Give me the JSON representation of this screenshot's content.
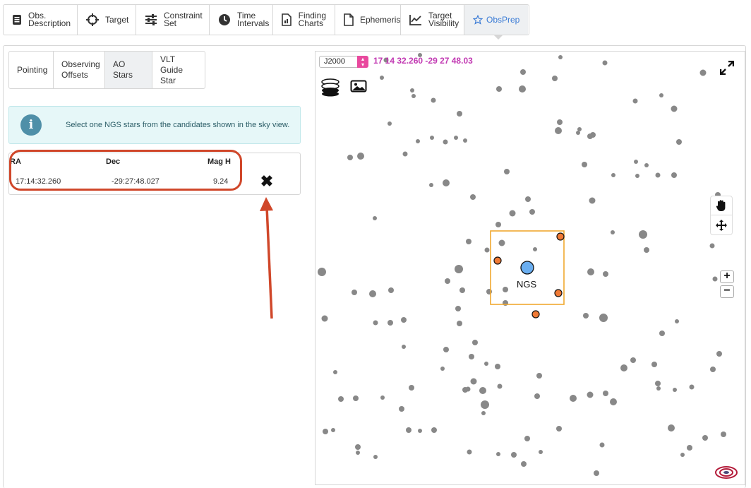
{
  "top_tabs": [
    {
      "label": "Obs.\nDescription",
      "icon": "document-icon",
      "active": false
    },
    {
      "label": "Target",
      "icon": "crosshair-icon",
      "active": false
    },
    {
      "label": "Constraint\nSet",
      "icon": "sliders-icon",
      "active": false
    },
    {
      "label": "Time\nIntervals",
      "icon": "clock-icon",
      "active": false
    },
    {
      "label": "Finding\nCharts",
      "icon": "chart-file-icon",
      "active": false
    },
    {
      "label": "Ephemeris",
      "icon": "file-icon",
      "active": false
    },
    {
      "label": "Target\nVisibility",
      "icon": "line-chart-icon",
      "active": false
    },
    {
      "label": "ObsPrep",
      "icon": "star-icon",
      "active": true
    }
  ],
  "sub_tabs": [
    {
      "label": "Pointing",
      "active": false
    },
    {
      "label": "Observing\nOffsets",
      "active": false
    },
    {
      "label": "AO Stars",
      "active": true
    },
    {
      "label": "VLT Guide\nStar",
      "active": false
    }
  ],
  "alert": {
    "icon": "info-icon",
    "icon_text": "i",
    "message": "Select one NGS stars from the candidates shown in the sky view."
  },
  "stars_table": {
    "columns": [
      "RA",
      "Dec",
      "Mag H"
    ],
    "rows": [
      {
        "ra": "17:14:32.260",
        "dec": "-29:27:48.027",
        "mag_h": "9.24"
      }
    ],
    "remove_symbol": "✖"
  },
  "sky_view": {
    "frame": "J2000",
    "coordinates": "17 14 32.260 -29 27 48.03",
    "ngs_label": "NGS",
    "zoom_in": "+",
    "zoom_out": "−",
    "colors": {
      "star": "#888888",
      "ngs": "#6aaef0",
      "candidate": "#f07a35",
      "fov_box": "#f0a830",
      "coords": "#c23ab3",
      "annotation": "#d0472a"
    }
  }
}
